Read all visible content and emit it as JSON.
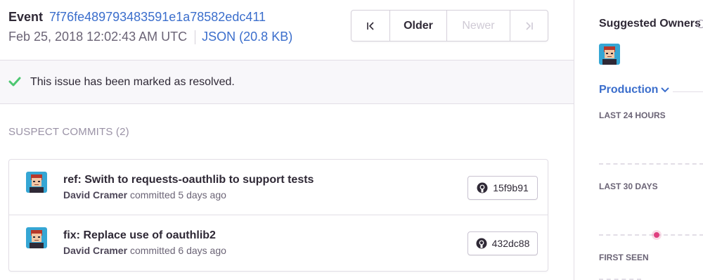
{
  "event": {
    "label": "Event",
    "id": "7f76fe489793483591e1a78582edc411",
    "date": "Feb 25, 2018 12:02:43 AM UTC",
    "json_link": "JSON (20.8 KB)"
  },
  "pager": {
    "first_icon": "first-page-icon",
    "older": "Older",
    "newer": "Newer",
    "last_icon": "last-page-icon"
  },
  "resolved_banner": {
    "icon": "check-icon",
    "message": "This issue has been marked as resolved."
  },
  "suspect_commits": {
    "title": "Suspect Commits (2)",
    "items": [
      {
        "message": "ref: Swith to requests-oauthlib to support tests",
        "author": "David Cramer",
        "when": "committed 5 days ago",
        "sha": "15f9b91"
      },
      {
        "message": "fix: Replace use of oauthlib2",
        "author": "David Cramer",
        "when": "committed 6 days ago",
        "sha": "432dc88"
      }
    ]
  },
  "sidebar": {
    "suggested_owners": "Suggested Owners",
    "environment": "Production",
    "last_24_hours": "Last 24 Hours",
    "last_30_days": "Last 30 Days",
    "first_seen": "First Seen"
  },
  "colors": {
    "link": "#3b6ecc",
    "success": "#4dc771",
    "sparkline_dot": "#e03e7f"
  }
}
